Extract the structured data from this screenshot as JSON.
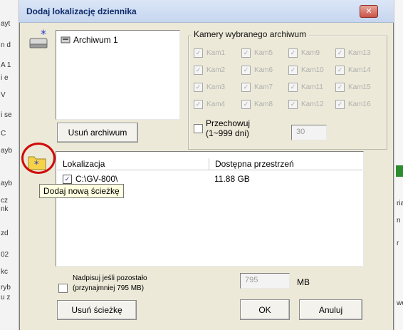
{
  "background": {
    "left_fragments": [
      "ayt",
      "n d",
      "A 1",
      "i e",
      "V",
      "i se",
      "C",
      "ayb",
      "ayb",
      "cz",
      "nk",
      "zd",
      "02",
      "kc",
      "ryb",
      "u z"
    ],
    "right_fragments": [
      "ria",
      "n",
      "r",
      "we"
    ]
  },
  "dialog": {
    "title": "Dodaj lokalizację dziennika",
    "close_label": "✕"
  },
  "archive_list": {
    "items": [
      "Archiwum 1"
    ]
  },
  "cameras_group": {
    "legend": "Kamery wybranego archiwum",
    "cameras": [
      [
        "Kam1",
        "Kam5",
        "Kam9",
        "Kam13"
      ],
      [
        "Kam2",
        "Kam6",
        "Kam10",
        "Kam14"
      ],
      [
        "Kam3",
        "Kam7",
        "Kam11",
        "Kam15"
      ],
      [
        "Kam4",
        "Kam8",
        "Kam12",
        "Kam16"
      ]
    ],
    "retain_label_line1": "Przechowuj",
    "retain_label_line2": "(1~999 dni)",
    "retain_value": "30"
  },
  "remove_archive_button": "Usuń archiwum",
  "paths_table": {
    "columns": [
      "Lokalizacja",
      "Dostępna przestrzeń"
    ],
    "rows": [
      {
        "path": "C:\\GV-800\\",
        "space": "11.88 GB",
        "checked": true
      }
    ]
  },
  "tooltip": "Dodaj nową ścieżkę",
  "overwrite": {
    "label_line1": "Nadpisuj jeśli pozostało",
    "label_line2": "(przynajmniej 795 MB)",
    "value": "795",
    "unit": "MB"
  },
  "buttons": {
    "remove_path": "Usuń ścieżkę",
    "ok": "OK",
    "cancel": "Anuluj"
  }
}
